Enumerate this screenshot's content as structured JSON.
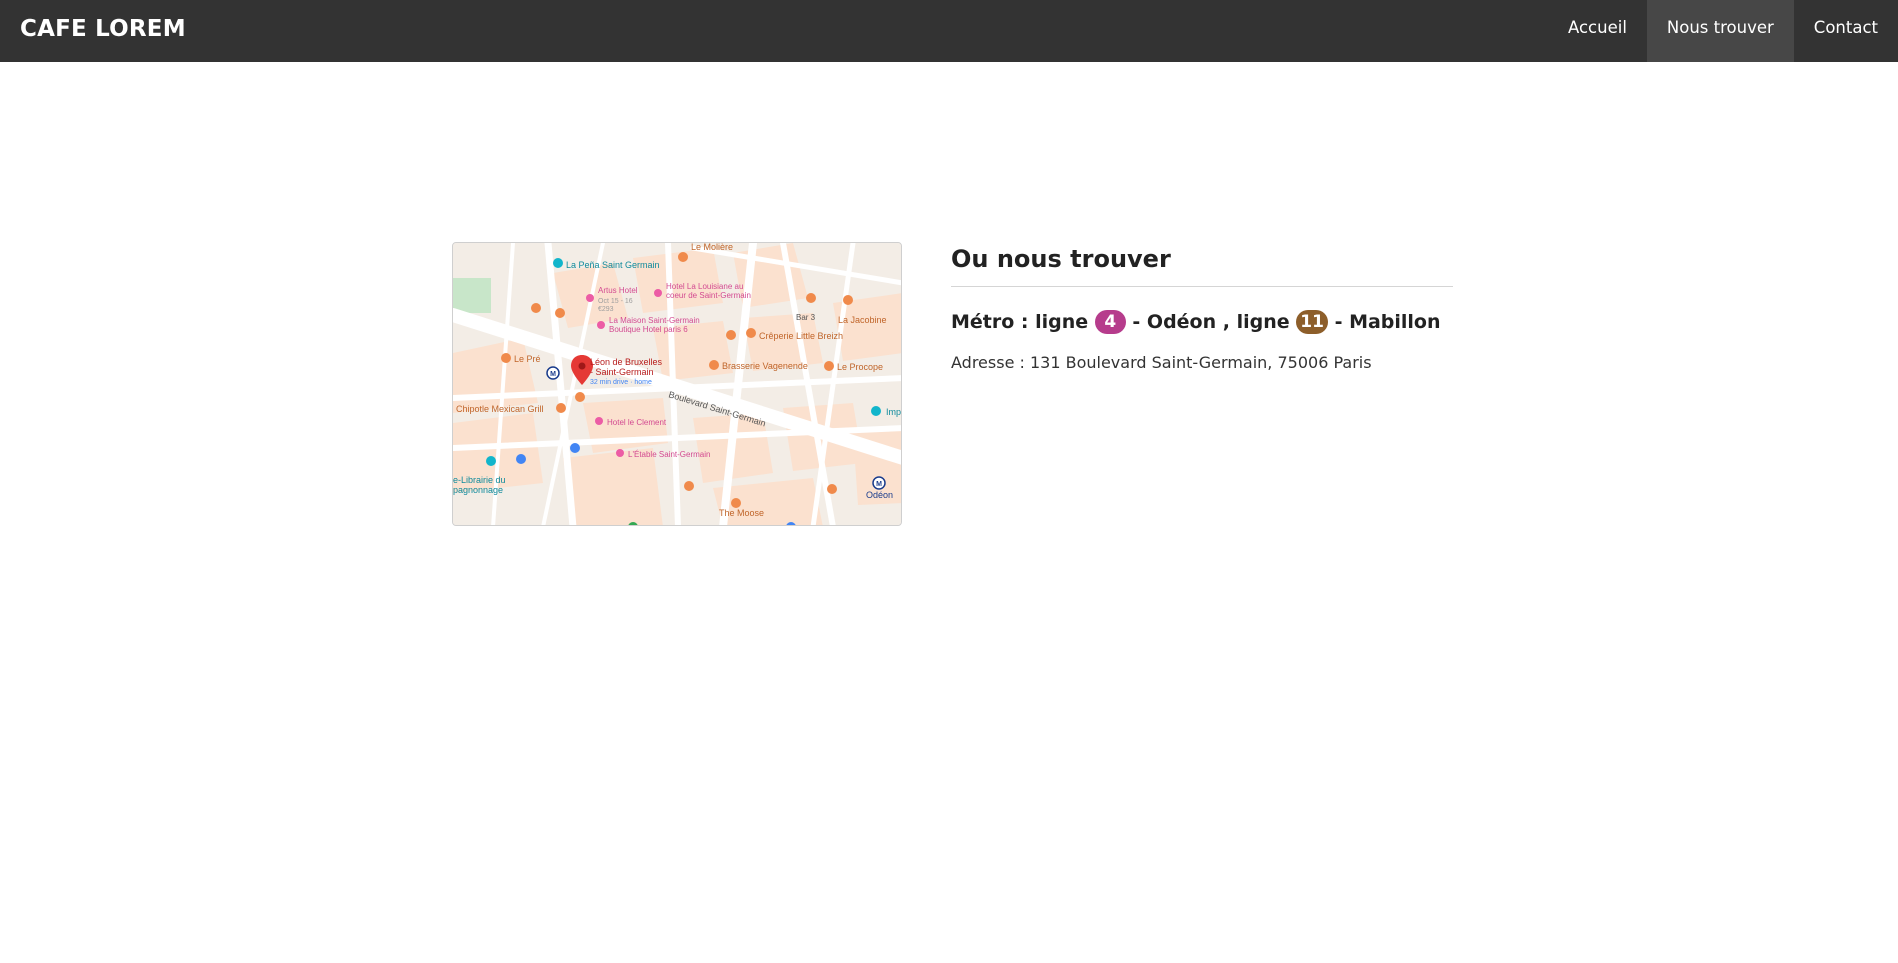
{
  "navbar": {
    "brand": "CAFE LOREM",
    "items": [
      {
        "label": "Accueil",
        "active": false
      },
      {
        "label": "Nous trouver",
        "active": true
      },
      {
        "label": "Contact",
        "active": false
      }
    ]
  },
  "map": {
    "labels": {
      "pena": "La Peña Saint Germain",
      "moliere": "Le Molière",
      "artus": "Artus Hotel",
      "artus_dates": "Oct 15 - 16",
      "artus_price": "€293",
      "louisiane_1": "Hotel La Louisiane au",
      "louisiane_2": "coeur de Saint-Germain",
      "maison_1": "La Maison Saint-Germain",
      "maison_2": "Boutique Hotel paris 6",
      "bar3": "Bar 3",
      "jacobine": "La Jacobine",
      "creperie": "Crêperie Little Breizh",
      "pre": "Le Pré",
      "leon_1": "Léon de Bruxelles",
      "leon_2": "- Saint-Germain",
      "leon_drive": "32 min drive · home",
      "vagenende": "Brasserie Vagenende",
      "procope": "Le Procope",
      "boulevard": "Boulevard Saint-Germain",
      "chipotle": "Chipotle Mexican Grill",
      "clement": "Hotel le Clement",
      "etable": "L'Étable Saint-Germain",
      "librairie_1": "e-Librairie du",
      "librairie_2": "pagnonnage",
      "odeon": "Odéon",
      "moose": "The Moose",
      "imp": "Imp"
    }
  },
  "info": {
    "title": "Ou nous trouver",
    "metro_prefix": "Métro : ligne",
    "line1_number": "4",
    "line1_color": "#b63c8c",
    "line1_station": "- Odéon , ligne",
    "line2_number": "11",
    "line2_color": "#8d5e2a",
    "line2_station": "- Mabillon",
    "address": "Adresse : 131 Boulevard Saint-Germain, 75006 Paris"
  }
}
